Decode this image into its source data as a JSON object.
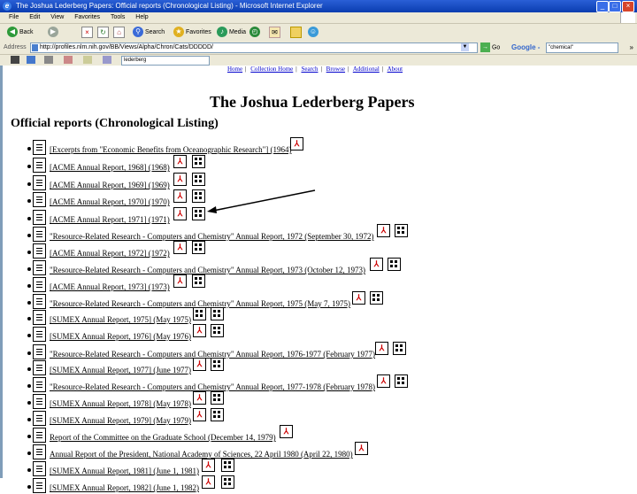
{
  "window": {
    "title": "The Joshua Lederberg Papers: Official reports (Chronological Listing) - Microsoft Internet Explorer",
    "min_glyph": "_",
    "max_glyph": "□",
    "close_glyph": "×"
  },
  "menu": [
    "File",
    "Edit",
    "View",
    "Favorites",
    "Tools",
    "Help"
  ],
  "toolbar": {
    "back_label": "Back",
    "search_label": "Search",
    "favorites_label": "Favorites",
    "media_label": "Media"
  },
  "address": {
    "label": "Address",
    "value": "http://profiles.nlm.nih.gov/BB/Views/Alpha/Chron/Cats/DDDDD/",
    "go_label": "Go",
    "google_label": "Google -",
    "google_query": "\"chemical\"",
    "more_glyph": "»"
  },
  "links": {
    "select_value": "lederberg"
  },
  "page": {
    "nav": [
      "Home",
      "Collection Home",
      "Search",
      "Browse",
      "Additional",
      "About"
    ],
    "title": "The Joshua Lederberg Papers",
    "section": "Official reports (Chronological Listing)",
    "items": [
      {
        "text": "[Excerpts from \"Economic Benefits from Oceanographic Research\"] (1964)",
        "icons": [
          "pdf"
        ]
      },
      {
        "text": "[ACME Annual Report, 1968] (1968)",
        "icons": [
          "pdf",
          "grid"
        ]
      },
      {
        "text": "[ACME Annual Report, 1969] (1969)",
        "icons": [
          "pdf",
          "grid"
        ]
      },
      {
        "text": "[ACME Annual Report, 1970] (1970)",
        "icons": [
          "pdf",
          "grid"
        ]
      },
      {
        "text": "[ACME Annual Report, 1971] (1971)",
        "icons": [
          "pdf",
          "grid"
        ]
      },
      {
        "text": "\"Resource-Related Research - Computers and Chemistry\" Annual Report, 1972 (September 30, 1972)",
        "icons": [
          "pdf",
          "grid"
        ]
      },
      {
        "text": "[ACME Annual Report, 1972] (1972)",
        "icons": [
          "pdf",
          "grid"
        ]
      },
      {
        "text": "\"Resource-Related Research - Computers and Chemistry\" Annual Report, 1973 (October 12, 1973)",
        "icons": [
          "pdf",
          "grid"
        ]
      },
      {
        "text": "[ACME Annual Report, 1973] (1973)",
        "icons": [
          "pdf",
          "grid"
        ]
      },
      {
        "text": "\"Resource-Related Research - Computers and Chemistry\" Annual Report, 1975 (May 7, 1975)",
        "icons": [
          "pdf",
          "grid"
        ]
      },
      {
        "text": "[SUMEX Annual Report, 1975] (May 1975)",
        "icons": [
          "grid",
          "grid"
        ]
      },
      {
        "text": "[SUMEX Annual Report, 1976] (May 1976)",
        "icons": [
          "pdf",
          "grid"
        ]
      },
      {
        "text": "\"Resource-Related Research - Computers and Chemistry\" Annual Report, 1976-1977 (February 1977)",
        "icons": [
          "pdf",
          "grid"
        ]
      },
      {
        "text": "[SUMEX Annual Report, 1977] (June 1977)",
        "icons": [
          "pdf",
          "grid"
        ]
      },
      {
        "text": "\"Resource-Related Research - Computers and Chemistry\" Annual Report, 1977-1978 (February 1978)",
        "icons": [
          "pdf",
          "grid"
        ]
      },
      {
        "text": "[SUMEX Annual Report, 1978] (May 1978)",
        "icons": [
          "pdf",
          "grid"
        ]
      },
      {
        "text": "[SUMEX Annual Report, 1979] (May 1979)",
        "icons": [
          "pdf",
          "grid"
        ]
      },
      {
        "text": "Report of the Committee on the Graduate School (December 14, 1979)",
        "icons": [
          "pdf"
        ]
      },
      {
        "text": "Annual Report of the President, National Academy of Sciences, 22 April 1980 (April 22, 1980)",
        "icons": [
          "pdf"
        ]
      },
      {
        "text": "[SUMEX Annual Report, 1981] (June 1, 1981)",
        "icons": [
          "pdf",
          "grid"
        ]
      },
      {
        "text": "[SUMEX Annual Report, 1982] (June 1, 1982)",
        "icons": [
          "pdf",
          "grid"
        ]
      }
    ]
  },
  "icon_glyphs": {
    "pdf": "⅄",
    "grid": ""
  },
  "colors": {
    "titlebar": "#0a3db0",
    "link": "#0000cc",
    "chrome": "#ece9d8"
  }
}
